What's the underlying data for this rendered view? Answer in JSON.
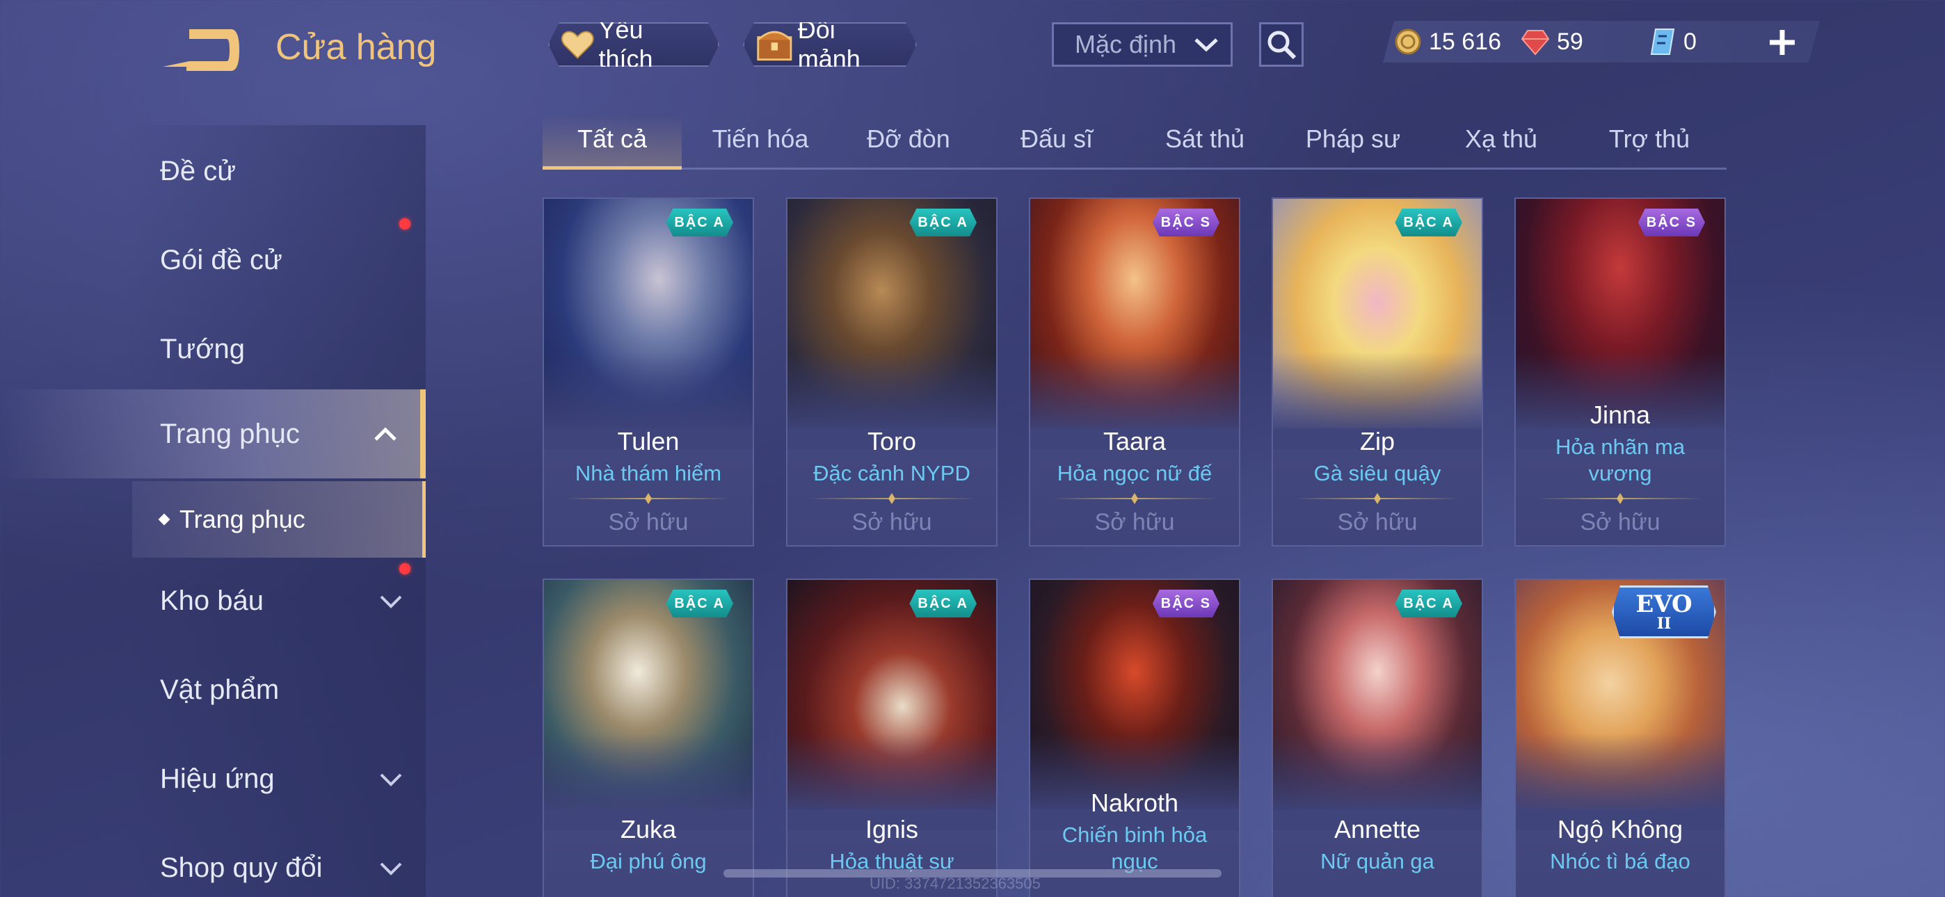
{
  "header": {
    "title": "Cửa hàng"
  },
  "sidebar": {
    "items": [
      {
        "label": "Đề cử"
      },
      {
        "label": "Gói đề cử"
      },
      {
        "label": "Tướng"
      },
      {
        "label": "Trang phục"
      },
      {
        "label": "Kho báu"
      },
      {
        "label": "Vật phẩm"
      },
      {
        "label": "Hiệu ứng"
      },
      {
        "label": "Shop quy đổi"
      }
    ],
    "sub_item": {
      "label": "Trang phục"
    }
  },
  "topbar": {
    "favorites_label": "Yêu thích",
    "exchange_label": "Đổi mảnh",
    "sort_value": "Mặc định"
  },
  "currency": {
    "gold": "15 616",
    "ruby": "59",
    "voucher": "0"
  },
  "tabs": [
    "Tất cả",
    "Tiến hóa",
    "Đỡ đòn",
    "Đấu sĩ",
    "Sát thủ",
    "Pháp sư",
    "Xạ thủ",
    "Trợ thủ"
  ],
  "cards": [
    {
      "hero": "Tulen",
      "skin": "Nhà thám hiểm",
      "tier": "BẬC A",
      "owned": "Sở hữu"
    },
    {
      "hero": "Toro",
      "skin": "Đặc cảnh NYPD",
      "tier": "BẬC A",
      "owned": "Sở hữu"
    },
    {
      "hero": "Taara",
      "skin": "Hỏa ngọc nữ đế",
      "tier": "BẬC S",
      "owned": "Sở hữu"
    },
    {
      "hero": "Zip",
      "skin": "Gà siêu quậy",
      "tier": "BẬC A",
      "owned": "Sở hữu"
    },
    {
      "hero": "Jinna",
      "skin": "Hỏa nhãn ma vương",
      "tier": "BẬC S",
      "owned": "Sở hữu"
    },
    {
      "hero": "Zuka",
      "skin": "Đại phú ông",
      "tier": "BẬC A"
    },
    {
      "hero": "Ignis",
      "skin": "Hỏa thuật sư",
      "tier": "BẬC A"
    },
    {
      "hero": "Nakroth",
      "skin": "Chiến binh hỏa ngục",
      "tier": "BẬC S"
    },
    {
      "hero": "Annette",
      "skin": "Nữ quản ga",
      "tier": "BẬC A"
    },
    {
      "hero": "Ngộ Không",
      "skin": "Nhóc tì bá đạo",
      "tier": "EVO",
      "tier_sub": "II"
    }
  ],
  "footer": {
    "watermark": "UID: 3374721352363505"
  },
  "colors": {
    "accent_gold": "#f0c57b",
    "skin_name": "#6ccaf2",
    "tier_a": "#28c4c0",
    "tier_s": "#a86ae0",
    "notification": "#ff3b40"
  }
}
